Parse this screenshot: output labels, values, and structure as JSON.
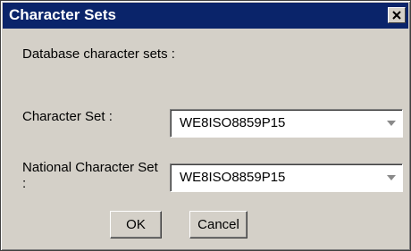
{
  "window": {
    "title": "Character Sets"
  },
  "content": {
    "heading": "Database character sets :",
    "character_set": {
      "label": "Character Set :",
      "value": "WE8ISO8859P15"
    },
    "national_character_set": {
      "label": "National Character Set :",
      "value": "WE8ISO8859P15"
    }
  },
  "buttons": {
    "ok": "OK",
    "cancel": "Cancel"
  },
  "icons": {
    "close": "close-icon",
    "dropdown": "chevron-down-icon"
  },
  "colors": {
    "titlebar": "#0a246a",
    "dialog_bg": "#d4d0c8",
    "field_bg": "#ffffff"
  }
}
